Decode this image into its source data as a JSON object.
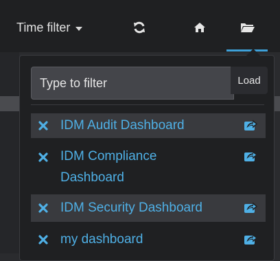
{
  "topbar": {
    "time_filter_label": "Time filter",
    "icons": [
      "refresh-icon",
      "home-icon",
      "folder-open-icon"
    ]
  },
  "dashboard_panel": {
    "filter_placeholder": "Type to filter",
    "load_label": "Load",
    "items": [
      {
        "label": "IDM Audit Dashboard"
      },
      {
        "label": "IDM Compliance Dashboard"
      },
      {
        "label": "IDM Security Dashboard"
      },
      {
        "label": "my dashboard"
      }
    ]
  },
  "colors": {
    "accent": "#4fb0e6",
    "background": "#1f2022",
    "row_highlight": "#393a3e"
  }
}
